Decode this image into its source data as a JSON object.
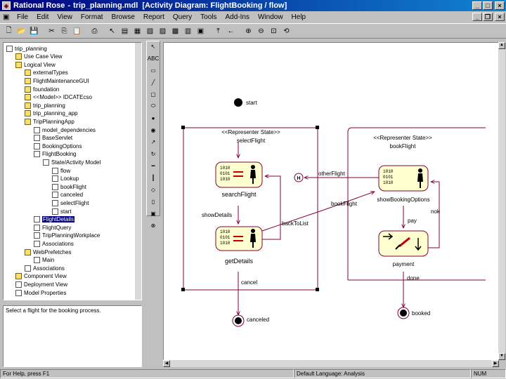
{
  "window": {
    "app": "Rational Rose",
    "file": "trip_planning.mdl",
    "view": "[Activity Diagram: FlightBooking / flow]"
  },
  "menu": [
    "File",
    "Edit",
    "View",
    "Format",
    "Browse",
    "Report",
    "Query",
    "Tools",
    "Add-Ins",
    "Window",
    "Help"
  ],
  "tree": [
    {
      "label": "trip_planning",
      "indent": 0,
      "icon": "pkg"
    },
    {
      "label": "Use Case View",
      "indent": 1,
      "icon": "folder"
    },
    {
      "label": "Logical View",
      "indent": 1,
      "icon": "folder"
    },
    {
      "label": "externalTypes",
      "indent": 2,
      "icon": "folder"
    },
    {
      "label": "FlightMaintenanceGUI",
      "indent": 2,
      "icon": "folder"
    },
    {
      "label": "foundation",
      "indent": 2,
      "icon": "folder"
    },
    {
      "label": "<<Model>> IDCATEcso",
      "indent": 2,
      "icon": "folder"
    },
    {
      "label": "trip_planning",
      "indent": 2,
      "icon": "folder"
    },
    {
      "label": "trip_planning_app",
      "indent": 2,
      "icon": "folder"
    },
    {
      "label": "TripPlanningApp",
      "indent": 2,
      "icon": "folder"
    },
    {
      "label": "model_dependencies",
      "indent": 3,
      "icon": "pkg"
    },
    {
      "label": "BaseServlet",
      "indent": 3,
      "icon": "pkg"
    },
    {
      "label": "BookingOptions",
      "indent": 3,
      "icon": "pkg"
    },
    {
      "label": "FlightBooking",
      "indent": 3,
      "icon": "pkg"
    },
    {
      "label": "State/Activity Model",
      "indent": 4,
      "icon": "pkg"
    },
    {
      "label": "flow",
      "indent": 5,
      "icon": "pkg"
    },
    {
      "label": "Lookup",
      "indent": 5,
      "icon": "pkg"
    },
    {
      "label": "bookFlight",
      "indent": 5,
      "icon": "pkg"
    },
    {
      "label": "canceled",
      "indent": 5,
      "icon": "pkg"
    },
    {
      "label": "selectFlight",
      "indent": 5,
      "icon": "pkg"
    },
    {
      "label": "start",
      "indent": 5,
      "icon": "pkg"
    },
    {
      "label": "FlightDetails",
      "indent": 3,
      "icon": "pkg",
      "selected": true
    },
    {
      "label": "FlightQuery",
      "indent": 3,
      "icon": "pkg"
    },
    {
      "label": "TripPlanningWorkplace",
      "indent": 3,
      "icon": "pkg"
    },
    {
      "label": "Associations",
      "indent": 3,
      "icon": "pkg"
    },
    {
      "label": "WebPrefetches",
      "indent": 2,
      "icon": "folder"
    },
    {
      "label": "Main",
      "indent": 3,
      "icon": "pkg"
    },
    {
      "label": "Associations",
      "indent": 2,
      "icon": "pkg"
    },
    {
      "label": "Component View",
      "indent": 1,
      "icon": "folder"
    },
    {
      "label": "Deployment View",
      "indent": 1,
      "icon": "pkg"
    },
    {
      "label": "Model Properties",
      "indent": 1,
      "icon": "pkg"
    }
  ],
  "documentation": "Select a flight for the booking process.",
  "diagram": {
    "start": "start",
    "state_left_stereo": "<<Representer State>>",
    "state_left_name": "selectFlight",
    "state_right_stereo": "<<Representer State>>",
    "state_right_name": "bookFlight",
    "act_search": "searchFlight",
    "act_details": "getDetails",
    "act_options": "showBookingOptions",
    "act_payment": "payment",
    "lbl_otherflight": "otherFlight",
    "lbl_bookflight": "bookFlight",
    "lbl_showdetails": "showDetails",
    "lbl_backtolist": "backToList",
    "lbl_cancel": "cancel",
    "lbl_pay": "pay",
    "lbl_done": "done",
    "lbl_nok": "nok",
    "end_canceled": "canceled",
    "end_booked": "booked"
  },
  "status": {
    "help": "For Help, press F1",
    "language": "Default Language: Analysis",
    "num": "NUM"
  }
}
